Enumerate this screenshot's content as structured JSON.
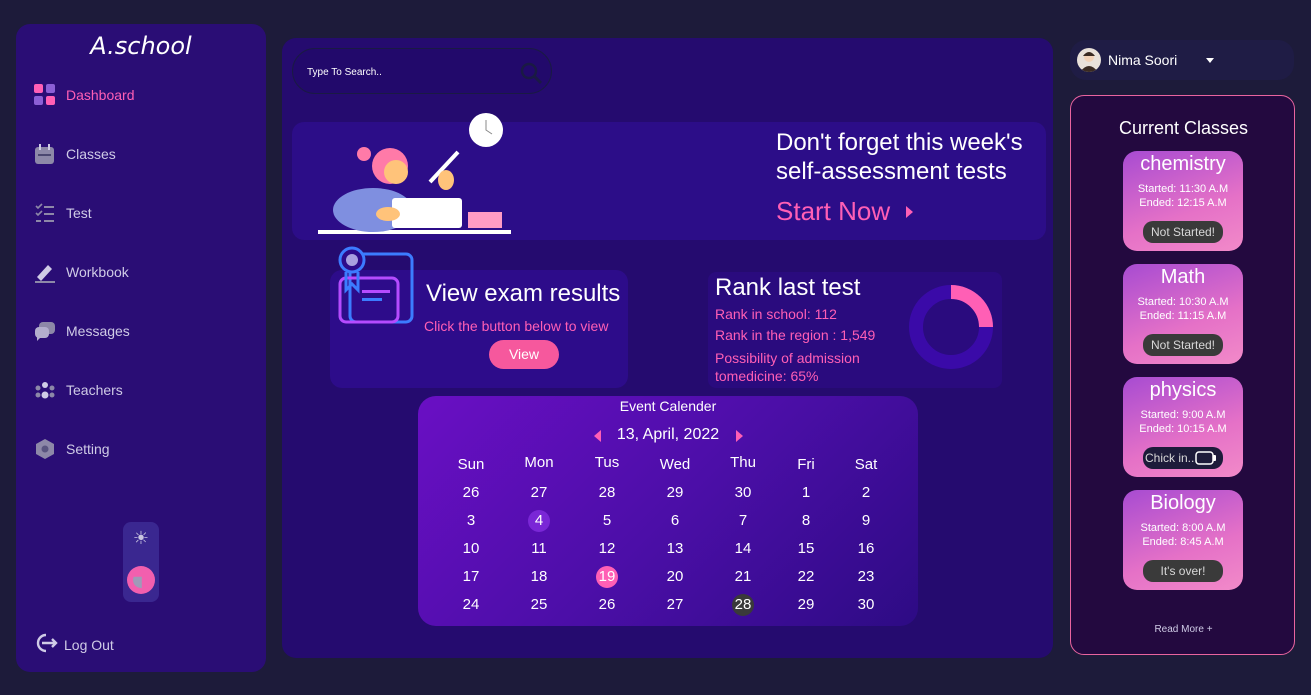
{
  "sidebar": {
    "logo": "A.school",
    "items": [
      {
        "label": "Dashboard",
        "icon": "dashboard-icon",
        "active": true
      },
      {
        "label": "Classes",
        "icon": "calendar-icon"
      },
      {
        "label": "Test",
        "icon": "checklist-icon"
      },
      {
        "label": "Workbook",
        "icon": "pen-icon"
      },
      {
        "label": "Messages",
        "icon": "chat-icon"
      },
      {
        "label": "Teachers",
        "icon": "people-icon"
      },
      {
        "label": "Setting",
        "icon": "gear-icon"
      }
    ],
    "logout": "Log Out"
  },
  "search": {
    "placeholder": "Type To Search.."
  },
  "banner": {
    "title": "Don't forget this week's self-assessment tests",
    "cta": "Start Now"
  },
  "exam": {
    "title": "View exam results",
    "subtitle": "Click the button below to view",
    "button": "View"
  },
  "rank": {
    "title": "Rank last test",
    "school": "Rank in school: 112",
    "region": "Rank in the region : 1,549",
    "admission_line1": "Possibility of admission",
    "admission_line2": "tomedicine: 65%",
    "progress_fraction": 0.25
  },
  "calendar": {
    "title": "Event Calender",
    "current": "13, April, 2022",
    "weekdays": [
      "Sun",
      "Mon",
      "Tus",
      "Wed",
      "Thu",
      "Fri",
      "Sat"
    ],
    "weeks": [
      [
        "26",
        "27",
        "28",
        "29",
        "30",
        "1",
        "2"
      ],
      [
        "3",
        "4",
        "5",
        "6",
        "7",
        "8",
        "9"
      ],
      [
        "10",
        "11",
        "12",
        "13",
        "14",
        "15",
        "16"
      ],
      [
        "17",
        "18",
        "19",
        "20",
        "21",
        "22",
        "23"
      ],
      [
        "24",
        "25",
        "26",
        "27",
        "28",
        "29",
        "30"
      ]
    ]
  },
  "profile": {
    "name": "Nima Soori"
  },
  "classes": {
    "title": "Current Classes",
    "items": [
      {
        "name": "chemistry",
        "started": "Started: 11:30 A.M",
        "ended": "Ended: 12:15 A.M",
        "status": "Not Started!"
      },
      {
        "name": "Math",
        "started": "Started: 10:30 A.M",
        "ended": "Ended: 11:15 A.M",
        "status": "Not Started!"
      },
      {
        "name": "physics",
        "started": "Started: 9:00 A.M",
        "ended": "Ended: 10:15 A.M",
        "status": "Chick in..."
      },
      {
        "name": "Biology",
        "started": "Started: 8:00 A.M",
        "ended": "Ended: 8:45 A.M",
        "status": "It's over!"
      }
    ],
    "read_more": "Read More +"
  },
  "colors": {
    "accent": "#ff5fb5",
    "sidebar": "#2a0d75",
    "main": "#250b6f",
    "background": "#1d1b3a"
  }
}
